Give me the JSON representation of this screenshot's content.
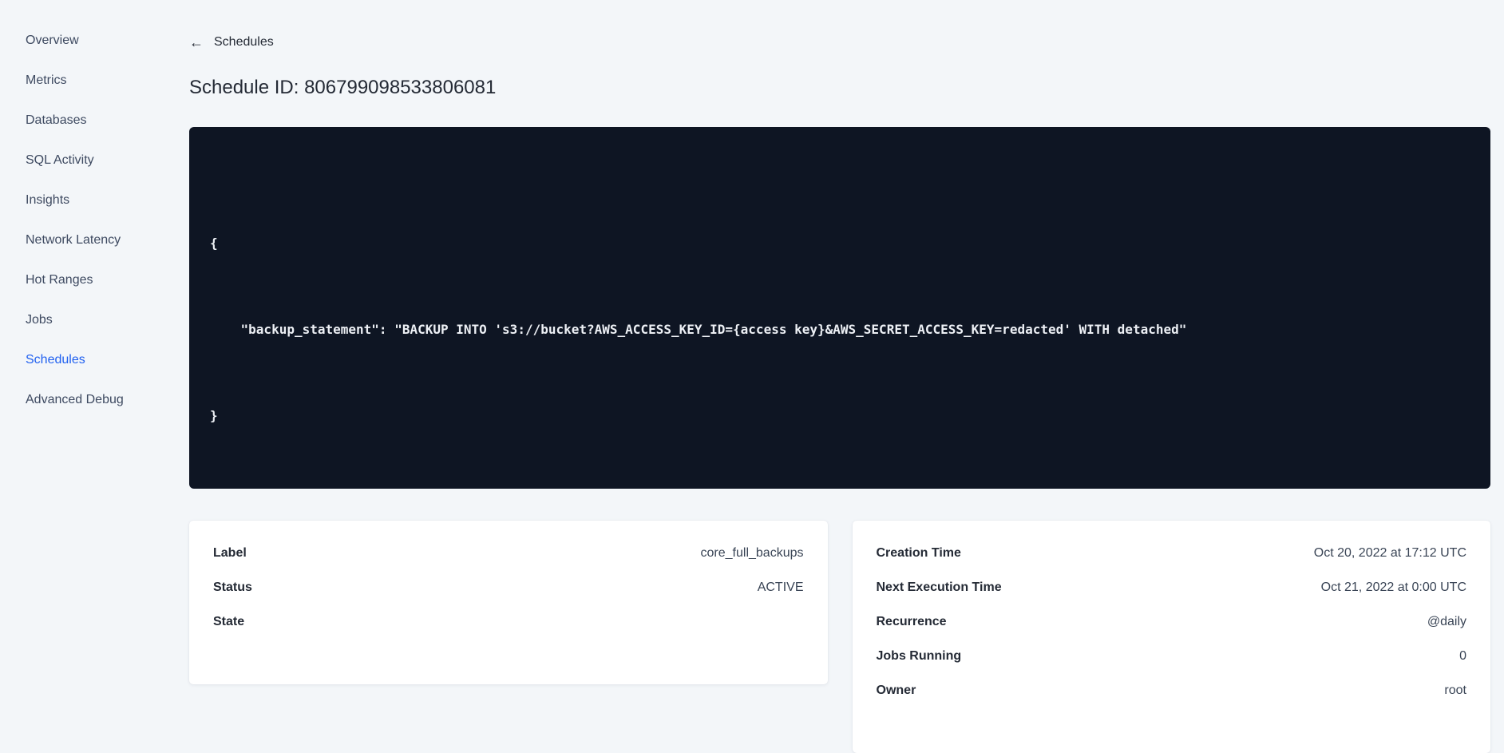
{
  "sidebar": {
    "items": [
      {
        "label": "Overview",
        "active": false
      },
      {
        "label": "Metrics",
        "active": false
      },
      {
        "label": "Databases",
        "active": false
      },
      {
        "label": "SQL Activity",
        "active": false
      },
      {
        "label": "Insights",
        "active": false
      },
      {
        "label": "Network Latency",
        "active": false
      },
      {
        "label": "Hot Ranges",
        "active": false
      },
      {
        "label": "Jobs",
        "active": false
      },
      {
        "label": "Schedules",
        "active": true
      },
      {
        "label": "Advanced Debug",
        "active": false
      }
    ]
  },
  "header": {
    "back_icon": "←",
    "back_label": "Schedules",
    "title": "Schedule ID: 806799098533806081"
  },
  "code_block": {
    "lines": [
      "{",
      "    \"backup_statement\": \"BACKUP INTO 's3://bucket?AWS_ACCESS_KEY_ID={access key}&AWS_SECRET_ACCESS_KEY=redacted' WITH detached\"",
      "}"
    ]
  },
  "schedule_details": {
    "rows": [
      {
        "label": "Label",
        "value": "core_full_backups"
      },
      {
        "label": "Status",
        "value": "ACTIVE"
      },
      {
        "label": "State",
        "value": ""
      }
    ]
  },
  "execution_details": {
    "rows": [
      {
        "label": "Creation Time",
        "value": "Oct 20, 2022 at 17:12 UTC"
      },
      {
        "label": "Next Execution Time",
        "value": "Oct 21, 2022 at 0:00 UTC"
      },
      {
        "label": "Recurrence",
        "value": "@daily"
      },
      {
        "label": "Jobs Running",
        "value": "0"
      },
      {
        "label": "Owner",
        "value": "root"
      }
    ]
  },
  "colors": {
    "page_background": "#f3f6f9",
    "active_link_blue": "#2161f0",
    "code_background": "#0e1523",
    "text_dark": "#242a35"
  }
}
